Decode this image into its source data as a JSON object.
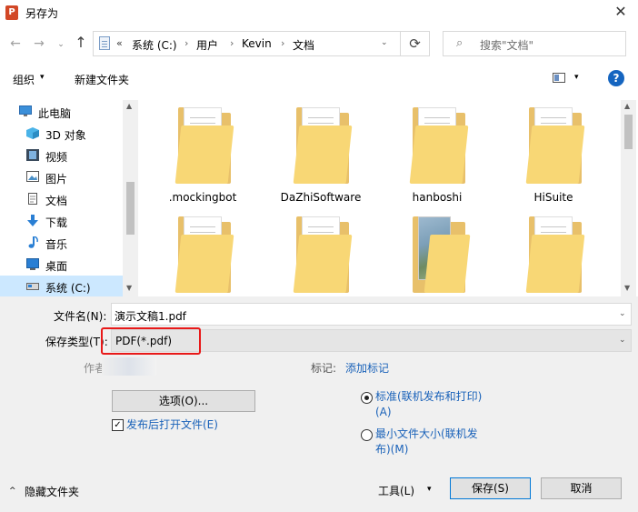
{
  "window": {
    "title": "另存为",
    "app_icon": "powerpoint-icon",
    "close_glyph": "✕"
  },
  "nav": {
    "back_glyph": "←",
    "forward_glyph": "→",
    "recent_glyph": "⌄",
    "up_glyph": "↑",
    "refresh_glyph": "⟳",
    "dropdown_glyph": "⌄"
  },
  "address": {
    "overflow": "«",
    "crumbs": [
      "系统 (C:)",
      "用户",
      "Kevin",
      "文档"
    ],
    "separator": "›"
  },
  "search": {
    "placeholder": "搜索\"文档\"",
    "icon_glyph": "⌕"
  },
  "toolbar": {
    "organize": "组织",
    "caret": "▾",
    "new_folder": "新建文件夹",
    "help": "?"
  },
  "nav_pane": {
    "items": [
      {
        "label": "此电脑",
        "icon": "pc-icon"
      },
      {
        "label": "3D 对象",
        "icon": "3d-objects-icon"
      },
      {
        "label": "视频",
        "icon": "video-icon"
      },
      {
        "label": "图片",
        "icon": "pictures-icon"
      },
      {
        "label": "文档",
        "icon": "documents-icon"
      },
      {
        "label": "下载",
        "icon": "downloads-icon"
      },
      {
        "label": "音乐",
        "icon": "music-icon"
      },
      {
        "label": "桌面",
        "icon": "desktop-icon"
      },
      {
        "label": "系统 (C:)",
        "icon": "drive-icon",
        "selected": true
      }
    ]
  },
  "folders": [
    {
      "name": ".mockingbot",
      "kind": "paper"
    },
    {
      "name": "DaZhiSoftware",
      "kind": "doc"
    },
    {
      "name": "hanboshi",
      "kind": "doc"
    },
    {
      "name": "HiSuite",
      "kind": "doc"
    },
    {
      "name": "",
      "kind": "paper"
    },
    {
      "name": "",
      "kind": "doc"
    },
    {
      "name": "",
      "kind": "photo"
    },
    {
      "name": "",
      "kind": "doc"
    }
  ],
  "form": {
    "filename_label": "文件名(N):",
    "filename_value": "演示文稿1.pdf",
    "filetype_label": "保存类型(T):",
    "filetype_value": "PDF(*.pdf)",
    "author_label": "作者",
    "tags_label": "标记:",
    "tags_link": "添加标记",
    "options_button": "选项(O)...",
    "open_after": "发布后打开文件(E)",
    "open_after_checked": true,
    "optimize": [
      {
        "label_line1": "标准(联机发布和打印)",
        "label_line2": "(A)",
        "selected": true
      },
      {
        "label_line1": "最小文件大小(联机发",
        "label_line2": "布)(M)",
        "selected": false
      }
    ]
  },
  "footer": {
    "hide_folders": "隐藏文件夹",
    "hide_caret": "^",
    "tools": "工具(L)",
    "tools_caret": "▾",
    "save": "保存(S)",
    "cancel": "取消"
  },
  "colors": {
    "accent": "#1a62b9",
    "highlight": "#e81919",
    "selected_bg": "#cce8ff",
    "folder": "#f8d775"
  }
}
